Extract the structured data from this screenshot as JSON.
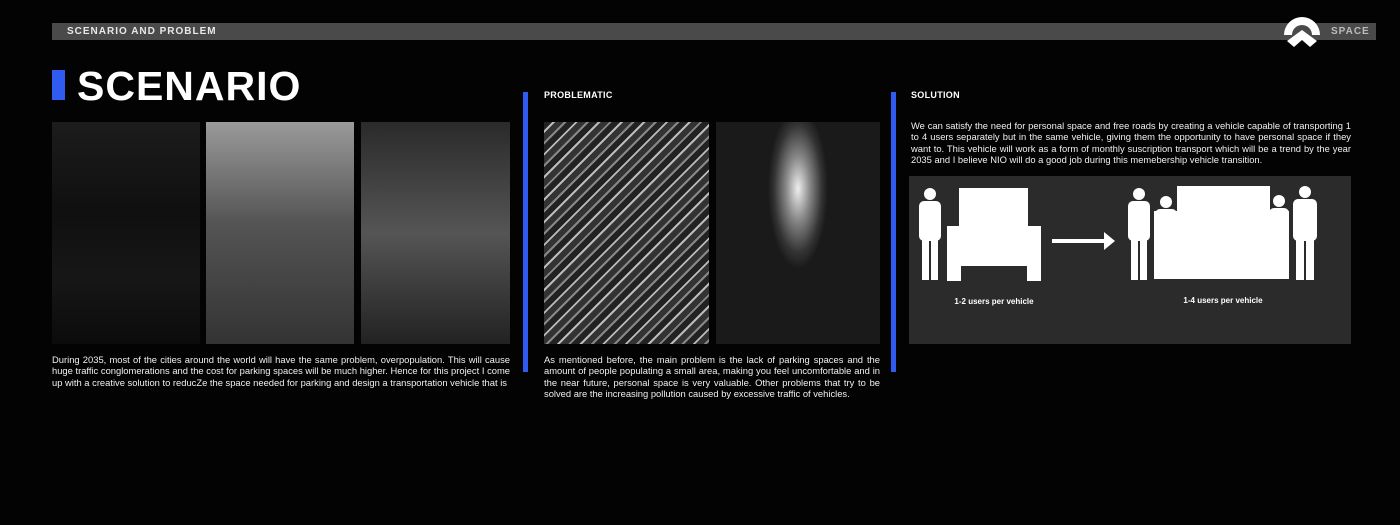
{
  "header": {
    "section_label": "SCENARIO AND PROBLEM",
    "brand": "SPACE"
  },
  "scenario": {
    "title": "SCENARIO",
    "text": "During 2035, most of the cities around the world will have the same problem, overpopulation. This will cause huge traffic conglomerations and the cost for parking spaces will be much higher. Hence for this project I come up with a creative solution to reducZe the space needed for parking and design a transportation vehicle that is"
  },
  "problematic": {
    "label": "PROBLEMATIC",
    "text": "As mentioned before, the main problem is the lack of parking spaces and the amount of people populating a small area, making you feel uncomfortable and in the near future, personal space is very valuable. Other problems that try to be solved are the increasing pollution caused by excessive traffic of vehicles."
  },
  "solution": {
    "label": "SOLUTION",
    "text": "We can satisfy the need for personal space and free roads by creating a vehicle capable of transporting 1 to 4 users separately but in the same vehicle, giving them the opportunity to have personal space if they want to. This vehicle will work as a form of monthly suscription transport which will be a trend by the year 2035 and I believe NIO will do a good job during this memebership vehicle transition.",
    "diagram": {
      "before_label": "1-2 users per vehicle",
      "after_label": "1-4 users per vehicle"
    }
  },
  "colors": {
    "accent": "#2f5bf0",
    "bar": "#4a4a4a",
    "diagram_bg": "#2b2b2b"
  }
}
